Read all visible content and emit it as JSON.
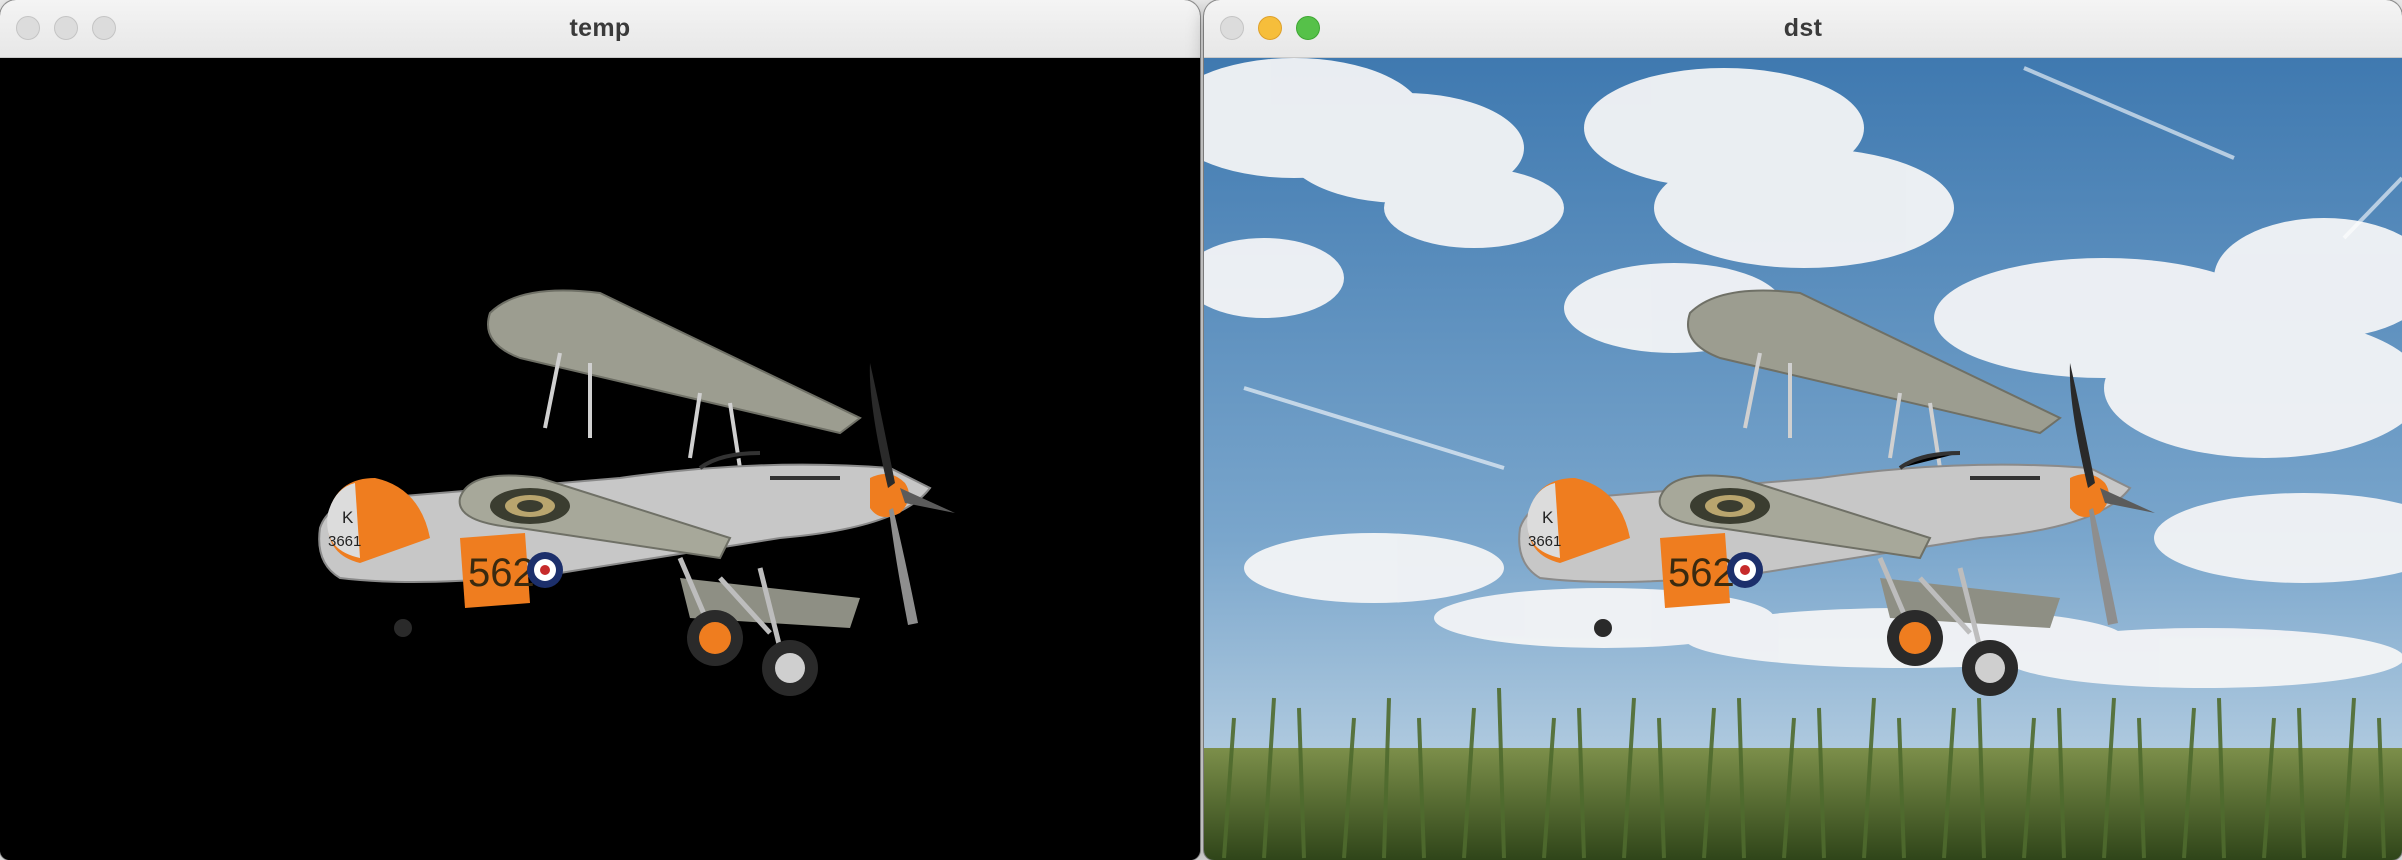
{
  "windows": [
    {
      "id": "temp",
      "title": "temp",
      "controls": {
        "close": "close-button",
        "minimize": "minimize-button",
        "zoom": "zoom-button"
      },
      "background": "#000000"
    },
    {
      "id": "dst",
      "title": "dst",
      "controls": {
        "close": "close-button",
        "minimize": "minimize-button",
        "zoom": "zoom-button"
      },
      "accent_yellow": "#f6be3b",
      "accent_green": "#56c149"
    }
  ],
  "aircraft": {
    "fuselage_number": "562",
    "tail_letter": "K",
    "tail_serial": "3661",
    "colors": {
      "body": "#c9c9c9",
      "wing": "#a7a89a",
      "orange": "#ef7d1f",
      "roundel_outer": "#3b3d30",
      "roundel_ring": "#b9a56e"
    }
  },
  "scene_colors": {
    "sky_top": "#3f79b0",
    "sky_bottom": "#a9c6dd",
    "cloud": "#f3f4f6",
    "corn": "#4f6b2e"
  }
}
